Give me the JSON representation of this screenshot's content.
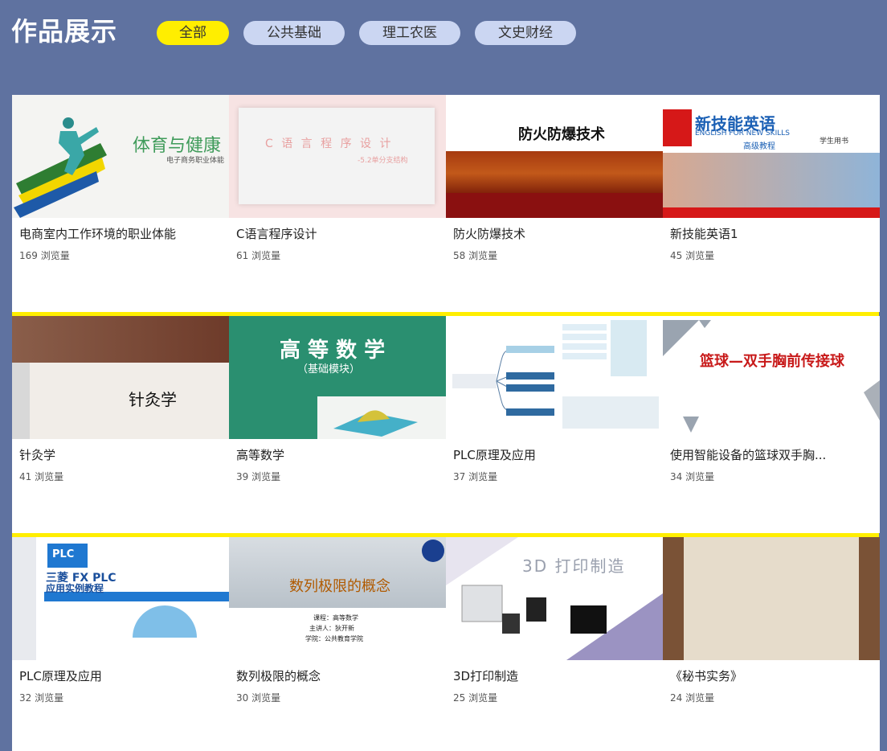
{
  "header": {
    "title": "作品展示",
    "tabs": [
      {
        "label": "全部",
        "active": true
      },
      {
        "label": "公共基础",
        "active": false
      },
      {
        "label": "理工农医",
        "active": false
      },
      {
        "label": "文史财经",
        "active": false
      }
    ]
  },
  "colors": {
    "background": "#5f72a0",
    "accent": "#ffee00",
    "tab": "#cbd6f2"
  },
  "views_suffix": "浏览量",
  "cards": [
    {
      "title": "电商室内工作环境的职业体能",
      "views": "169 浏览量",
      "cover_text": [
        "体育与健康",
        "电子商务职业体能"
      ]
    },
    {
      "title": "C语言程序设计",
      "views": "61 浏览量",
      "cover_text": [
        "C 语 言 程 序 设 计",
        "-5.2单分支结构"
      ]
    },
    {
      "title": "防火防爆技术",
      "views": "58 浏览量",
      "cover_text": [
        "防火防爆技术"
      ]
    },
    {
      "title": "新技能英语1",
      "views": "45 浏览量",
      "cover_text": [
        "新技能英语",
        "ENGLISH FOR NEW SKILLS",
        "高级教程",
        "学生用书"
      ]
    },
    {
      "title": "针灸学",
      "views": "41 浏览量",
      "cover_text": [
        "针灸学"
      ]
    },
    {
      "title": "高等数学",
      "views": "39 浏览量",
      "cover_text": [
        "高 等 数 学",
        "（基础模块）"
      ]
    },
    {
      "title": "PLC原理及应用",
      "views": "37 浏览量",
      "cover_text": []
    },
    {
      "title": "使用智能设备的篮球双手胸...",
      "views": "34 浏览量",
      "cover_text": [
        "篮球—双手胸前传接球"
      ]
    },
    {
      "title": "PLC原理及应用",
      "views": "32 浏览量",
      "cover_text": [
        "PLC",
        "三菱 FX PLC",
        "应用实例教程"
      ]
    },
    {
      "title": "数列极限的概念",
      "views": "30 浏览量",
      "cover_text": [
        "数列极限的概念",
        "课程：高等数学",
        "主讲人：狄开新",
        "学院：公共教育学院"
      ]
    },
    {
      "title": "3D打印制造",
      "views": "25 浏览量",
      "cover_text": [
        "3D 打印制造"
      ]
    },
    {
      "title": "《秘书实务》",
      "views": "24 浏览量",
      "cover_text": []
    }
  ]
}
